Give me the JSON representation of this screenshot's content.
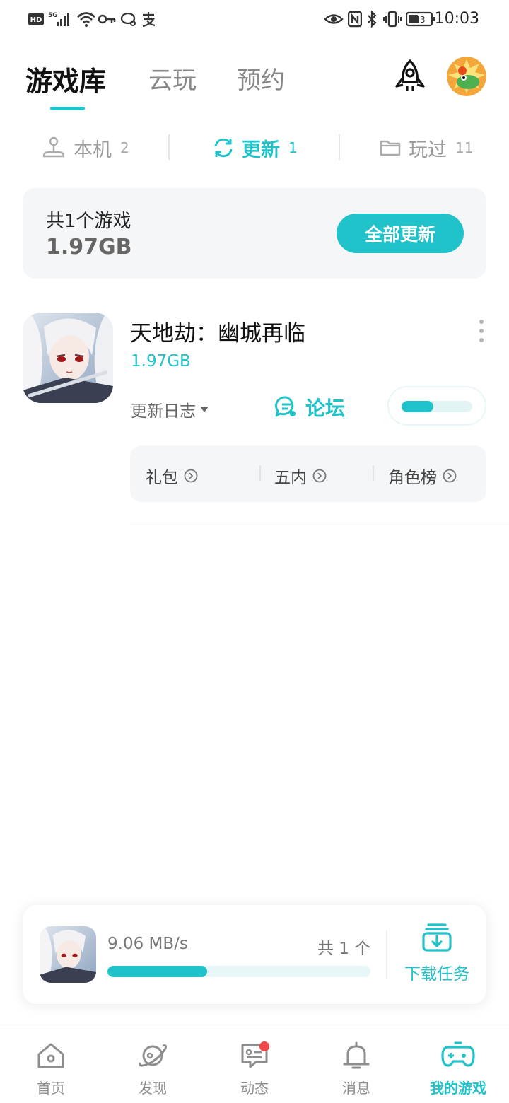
{
  "status_bar": {
    "time": "10:03",
    "battery": "43",
    "network": "5G",
    "hd_label": "HD",
    "icons": [
      "hd-icon",
      "signal-5g-icon",
      "wifi-icon",
      "key-icon",
      "chat-icon",
      "alipay-icon",
      "eye-icon",
      "nfc-icon",
      "bluetooth-icon",
      "vibrate-icon",
      "battery-icon"
    ]
  },
  "header": {
    "tabs": [
      {
        "label": "游戏库",
        "active": true
      },
      {
        "label": "云玩",
        "active": false
      },
      {
        "label": "预约",
        "active": false
      }
    ],
    "rocket_icon": "rocket-icon",
    "avatar": "avatar"
  },
  "subtabs": [
    {
      "label": "本机",
      "count": "2",
      "icon": "joystick-icon",
      "active": false
    },
    {
      "label": "更新",
      "count": "1",
      "icon": "refresh-icon",
      "active": true
    },
    {
      "label": "玩过",
      "count": "11",
      "icon": "folder-icon",
      "active": false
    }
  ],
  "summary": {
    "title": "共1个游戏",
    "size": "1.97GB",
    "update_all_label": "全部更新"
  },
  "game": {
    "name": "天地劫：幽城再临",
    "size": "1.97GB",
    "changelog_label": "更新日志",
    "forum_label": "论坛",
    "progress": 0.45,
    "links": [
      {
        "label": "礼包"
      },
      {
        "label": "五内"
      },
      {
        "label": "角色榜"
      }
    ]
  },
  "download": {
    "speed": "9.06 MB/s",
    "count": "共 1 个",
    "progress": 0.38,
    "task_label": "下载任务"
  },
  "nav": [
    {
      "label": "首页",
      "icon": "home-icon",
      "active": false
    },
    {
      "label": "发现",
      "icon": "planet-icon",
      "active": false
    },
    {
      "label": "动态",
      "icon": "message-icon",
      "active": false,
      "badge": true
    },
    {
      "label": "消息",
      "icon": "bell-icon",
      "active": false
    },
    {
      "label": "我的游戏",
      "icon": "gamepad-icon",
      "active": true
    }
  ],
  "colors": {
    "accent": "#1fc3c9",
    "card_bg": "#f4f6f8",
    "badge": "#f04848"
  }
}
